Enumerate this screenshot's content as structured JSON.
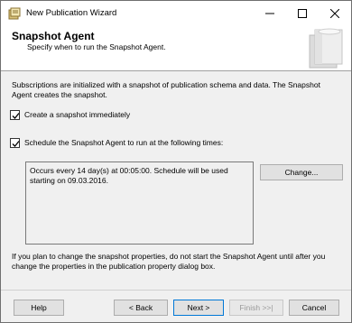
{
  "window": {
    "title": "New Publication Wizard"
  },
  "header": {
    "title": "Snapshot Agent",
    "subtitle": "Specify when to run the Snapshot Agent."
  },
  "main": {
    "description": "Subscriptions are initialized with a snapshot of publication schema and data. The Snapshot Agent creates the snapshot.",
    "options": [
      {
        "label": "Create a snapshot immediately",
        "checked": true
      },
      {
        "label": "Schedule the Snapshot Agent to run at the following times:",
        "checked": true
      }
    ],
    "schedule_text": "Occurs every 14 day(s) at 00:05:00. Schedule will be used starting on 09.03.2016.",
    "change_button": "Change...",
    "note": "If you plan to change the snapshot properties, do not start the Snapshot Agent until after you change the properties in the publication property dialog box."
  },
  "footer": {
    "help": "Help",
    "back": "< Back",
    "next": "Next >",
    "finish": "Finish >>|",
    "cancel": "Cancel"
  },
  "colors": {
    "accent": "#0078d7",
    "window_bg": "#f0f0f0",
    "header_bg": "#ffffff"
  }
}
